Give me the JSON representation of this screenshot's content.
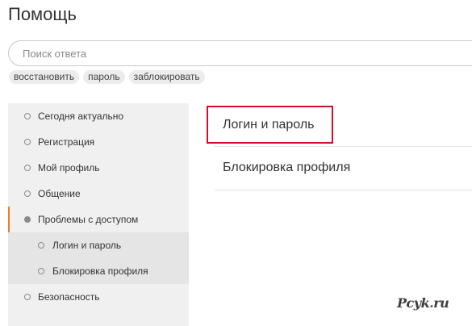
{
  "page_title": "Помощь",
  "search": {
    "placeholder": "Поиск ответа",
    "value": ""
  },
  "tags": [
    "восстановить",
    "пароль",
    "заблокировать"
  ],
  "sidebar": {
    "items": [
      {
        "label": "Сегодня актуально"
      },
      {
        "label": "Регистрация"
      },
      {
        "label": "Мой профиль"
      },
      {
        "label": "Общение"
      },
      {
        "label": "Проблемы с доступом",
        "active": true
      },
      {
        "label": "Логин и пароль",
        "sub": true
      },
      {
        "label": "Блокировка профиля",
        "sub": true
      },
      {
        "label": "Безопасность"
      }
    ]
  },
  "content": {
    "items": [
      {
        "label": "Логин и пароль",
        "highlighted": true
      },
      {
        "label": "Блокировка профиля"
      }
    ]
  },
  "colors": {
    "accent": "#f07f1d",
    "highlight_border": "#d0102a",
    "sidebar_bg": "#f0f0f0",
    "sub_bg": "#e5e5e5"
  },
  "watermark": {
    "brand": "Pcyk",
    "dot": ".",
    "tld": "ru"
  }
}
